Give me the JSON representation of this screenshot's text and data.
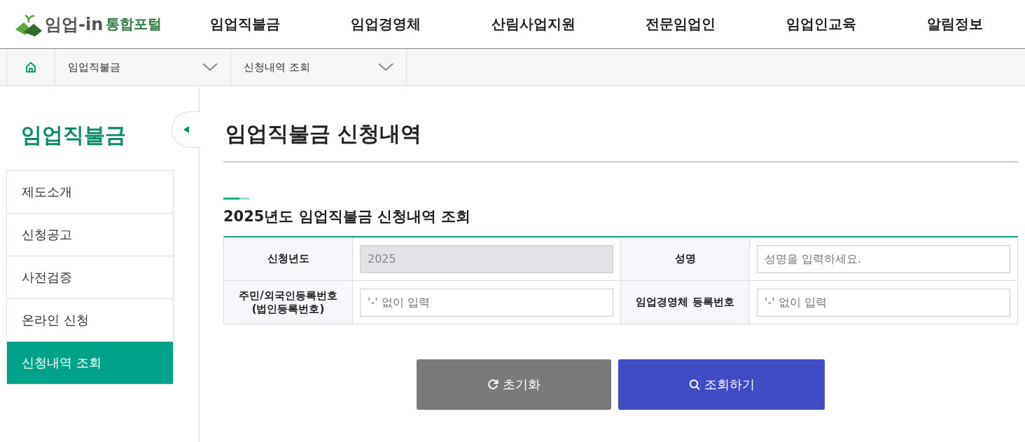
{
  "header": {
    "logo_text": "임업-in",
    "logo_subtext": "통합포털",
    "nav": [
      {
        "label": "임업직불금",
        "selected": false
      },
      {
        "label": "임업경영체",
        "selected": false
      },
      {
        "label": "산림사업지원",
        "selected": false
      },
      {
        "label": "전문임업인",
        "selected": false
      },
      {
        "label": "임업인교육",
        "selected": false
      },
      {
        "label": "알림정보",
        "selected": false
      }
    ]
  },
  "breadcrumb": [
    "임업직불금",
    "신청내역 조회"
  ],
  "sidebar": {
    "title": "임업직불금",
    "items": [
      {
        "label": "제도소개",
        "selected": false
      },
      {
        "label": "신청공고",
        "selected": false
      },
      {
        "label": "사전검증",
        "selected": false
      },
      {
        "label": "온라인 신청",
        "selected": false
      },
      {
        "label": "신청내역 조회",
        "selected": true
      }
    ]
  },
  "page_title": "임업직불금 신청내역",
  "section_title": "2025년도 임업직불금 신청내역 조회",
  "form": [
    {
      "label": "신청년도",
      "value": "2025",
      "disabled": true
    },
    {
      "label": "성명",
      "placeholder": "성명을 입력하세요.",
      "disabled": false
    },
    {
      "label": "주민/외국인등록번호\n(법인등록번호)",
      "placeholder": "'-' 없이 입력",
      "disabled": false
    },
    {
      "label": "임업경영체 등록번호",
      "placeholder": "'-' 없이 입력",
      "disabled": false
    }
  ],
  "buttons": [
    {
      "kind": "reset",
      "label": "초기화"
    },
    {
      "kind": "search",
      "label": "조회하기"
    }
  ]
}
